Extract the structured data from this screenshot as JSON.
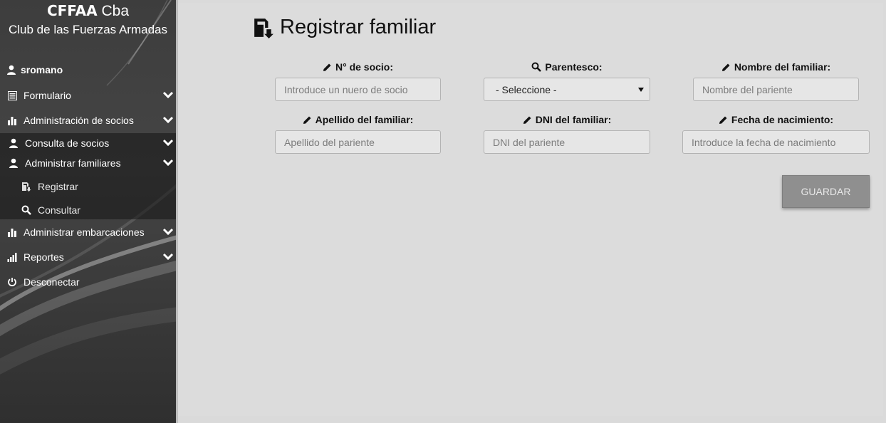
{
  "brand": {
    "title_bold": "CFFAA",
    "title_rest": "Cba",
    "subtitle": "Club de las Fuerzas Armadas"
  },
  "user": {
    "name": "sromano"
  },
  "menu": {
    "formulario": "Formulario",
    "admin_socios": "Administración de socios",
    "consulta_socios": "Consulta de socios",
    "admin_familiares": "Administrar familiares",
    "registrar": "Registrar",
    "consultar": "Consultar",
    "admin_embarcaciones": "Administrar embarcaciones",
    "reportes": "Reportes",
    "desconectar": "Desconectar"
  },
  "page": {
    "title": "Registrar familiar"
  },
  "form": {
    "socio": {
      "label": "N° de socio:",
      "placeholder": "Introduce un nuero de socio"
    },
    "parentesco": {
      "label": "Parentesco:",
      "selected": "- Seleccione -"
    },
    "nombre": {
      "label": "Nombre del familiar:",
      "placeholder": "Nombre del pariente"
    },
    "apellido": {
      "label": "Apellido del familiar:",
      "placeholder": "Apellido del pariente"
    },
    "dni": {
      "label": "DNI del familiar:",
      "placeholder": "DNI del pariente"
    },
    "fecha": {
      "label": "Fecha de nacimiento:",
      "placeholder": "Introduce la fecha de nacimiento"
    },
    "save_label": "GUARDAR"
  },
  "colors": {
    "sidebar": "#3d3d3d",
    "main_bg": "#dcdcdc",
    "button": "#8f8f8f"
  }
}
